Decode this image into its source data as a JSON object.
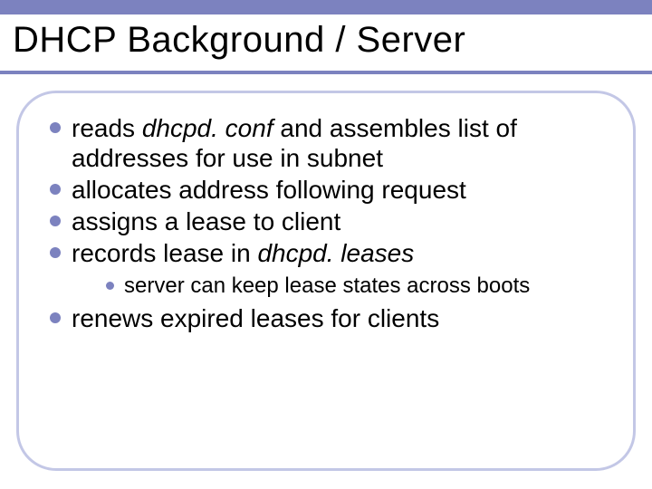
{
  "title": "DHCP Background / Server",
  "bullets": {
    "b1_pre": "reads ",
    "b1_em": "dhcpd. conf ",
    "b1_post": "and assembles list of addresses for use in subnet",
    "b2": "allocates address following request",
    "b3": "assigns a lease to client",
    "b4_pre": "records lease in ",
    "b4_em": "dhcpd. leases",
    "b4_sub1": "server can keep lease states across boots",
    "b5": "renews expired leases for clients"
  }
}
